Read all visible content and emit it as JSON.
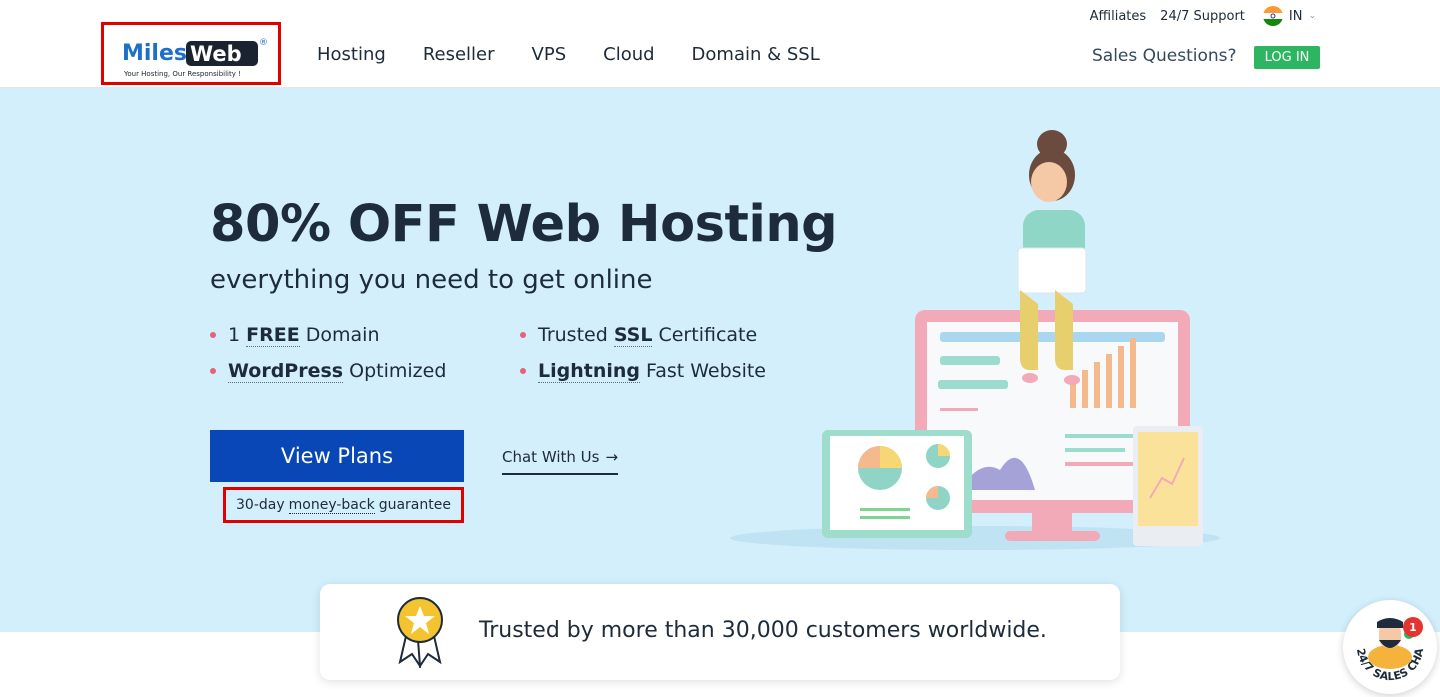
{
  "header": {
    "logo": {
      "brand_left": "Miles",
      "brand_right": "Web",
      "registered": "®",
      "tagline": "Your Hosting, Our Responsibility !"
    },
    "top_links": [
      "Affiliates",
      "24/7 Support"
    ],
    "region": "IN",
    "nav": [
      "Hosting",
      "Reseller",
      "VPS",
      "Cloud",
      "Domain & SSL"
    ],
    "sales_label": "Sales Questions?",
    "login_label": "LOG IN"
  },
  "hero": {
    "title": "80% OFF Web Hosting",
    "subtitle": "everything you need to get online",
    "features": [
      {
        "pre": "1 ",
        "bold": "FREE",
        "post": " Domain"
      },
      {
        "pre": "Trusted ",
        "bold": "SSL",
        "post": " Certificate"
      },
      {
        "pre": "",
        "bold": "WordPress",
        "post": " Optimized"
      },
      {
        "pre": "",
        "bold": "Lightning",
        "post": " Fast Website"
      }
    ],
    "cta_label": "View Plans",
    "guarantee": {
      "pre": "30-day",
      "link": "money-back",
      "post": "guarantee"
    },
    "chat_label": "Chat With Us",
    "chat_arrow": "→"
  },
  "trust": {
    "text": "Trusted by more than 30,000 customers worldwide."
  },
  "sales_chat": {
    "label": "24/7 SALES CHAT",
    "badge": "1"
  },
  "colors": {
    "hero_bg": "#d2effb",
    "cta_blue": "#0a47b6",
    "login_green": "#2db562",
    "highlight_red": "#e00000",
    "bullet_pink": "#e8607a"
  },
  "icons": [
    "india-flag-icon",
    "chevron-down-icon",
    "arrow-right-icon",
    "medal-icon",
    "sales-agent-avatar-icon"
  ]
}
